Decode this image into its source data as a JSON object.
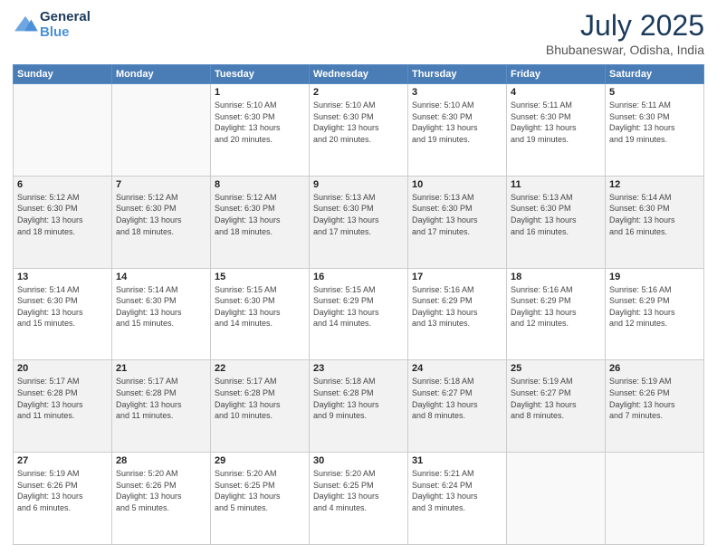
{
  "header": {
    "logo_line1": "General",
    "logo_line2": "Blue",
    "month_year": "July 2025",
    "location": "Bhubaneswar, Odisha, India"
  },
  "weekdays": [
    "Sunday",
    "Monday",
    "Tuesday",
    "Wednesday",
    "Thursday",
    "Friday",
    "Saturday"
  ],
  "weeks": [
    [
      {
        "day": "",
        "content": ""
      },
      {
        "day": "",
        "content": ""
      },
      {
        "day": "1",
        "content": "Sunrise: 5:10 AM\nSunset: 6:30 PM\nDaylight: 13 hours\nand 20 minutes."
      },
      {
        "day": "2",
        "content": "Sunrise: 5:10 AM\nSunset: 6:30 PM\nDaylight: 13 hours\nand 20 minutes."
      },
      {
        "day": "3",
        "content": "Sunrise: 5:10 AM\nSunset: 6:30 PM\nDaylight: 13 hours\nand 19 minutes."
      },
      {
        "day": "4",
        "content": "Sunrise: 5:11 AM\nSunset: 6:30 PM\nDaylight: 13 hours\nand 19 minutes."
      },
      {
        "day": "5",
        "content": "Sunrise: 5:11 AM\nSunset: 6:30 PM\nDaylight: 13 hours\nand 19 minutes."
      }
    ],
    [
      {
        "day": "6",
        "content": "Sunrise: 5:12 AM\nSunset: 6:30 PM\nDaylight: 13 hours\nand 18 minutes."
      },
      {
        "day": "7",
        "content": "Sunrise: 5:12 AM\nSunset: 6:30 PM\nDaylight: 13 hours\nand 18 minutes."
      },
      {
        "day": "8",
        "content": "Sunrise: 5:12 AM\nSunset: 6:30 PM\nDaylight: 13 hours\nand 18 minutes."
      },
      {
        "day": "9",
        "content": "Sunrise: 5:13 AM\nSunset: 6:30 PM\nDaylight: 13 hours\nand 17 minutes."
      },
      {
        "day": "10",
        "content": "Sunrise: 5:13 AM\nSunset: 6:30 PM\nDaylight: 13 hours\nand 17 minutes."
      },
      {
        "day": "11",
        "content": "Sunrise: 5:13 AM\nSunset: 6:30 PM\nDaylight: 13 hours\nand 16 minutes."
      },
      {
        "day": "12",
        "content": "Sunrise: 5:14 AM\nSunset: 6:30 PM\nDaylight: 13 hours\nand 16 minutes."
      }
    ],
    [
      {
        "day": "13",
        "content": "Sunrise: 5:14 AM\nSunset: 6:30 PM\nDaylight: 13 hours\nand 15 minutes."
      },
      {
        "day": "14",
        "content": "Sunrise: 5:14 AM\nSunset: 6:30 PM\nDaylight: 13 hours\nand 15 minutes."
      },
      {
        "day": "15",
        "content": "Sunrise: 5:15 AM\nSunset: 6:30 PM\nDaylight: 13 hours\nand 14 minutes."
      },
      {
        "day": "16",
        "content": "Sunrise: 5:15 AM\nSunset: 6:29 PM\nDaylight: 13 hours\nand 14 minutes."
      },
      {
        "day": "17",
        "content": "Sunrise: 5:16 AM\nSunset: 6:29 PM\nDaylight: 13 hours\nand 13 minutes."
      },
      {
        "day": "18",
        "content": "Sunrise: 5:16 AM\nSunset: 6:29 PM\nDaylight: 13 hours\nand 12 minutes."
      },
      {
        "day": "19",
        "content": "Sunrise: 5:16 AM\nSunset: 6:29 PM\nDaylight: 13 hours\nand 12 minutes."
      }
    ],
    [
      {
        "day": "20",
        "content": "Sunrise: 5:17 AM\nSunset: 6:28 PM\nDaylight: 13 hours\nand 11 minutes."
      },
      {
        "day": "21",
        "content": "Sunrise: 5:17 AM\nSunset: 6:28 PM\nDaylight: 13 hours\nand 11 minutes."
      },
      {
        "day": "22",
        "content": "Sunrise: 5:17 AM\nSunset: 6:28 PM\nDaylight: 13 hours\nand 10 minutes."
      },
      {
        "day": "23",
        "content": "Sunrise: 5:18 AM\nSunset: 6:28 PM\nDaylight: 13 hours\nand 9 minutes."
      },
      {
        "day": "24",
        "content": "Sunrise: 5:18 AM\nSunset: 6:27 PM\nDaylight: 13 hours\nand 8 minutes."
      },
      {
        "day": "25",
        "content": "Sunrise: 5:19 AM\nSunset: 6:27 PM\nDaylight: 13 hours\nand 8 minutes."
      },
      {
        "day": "26",
        "content": "Sunrise: 5:19 AM\nSunset: 6:26 PM\nDaylight: 13 hours\nand 7 minutes."
      }
    ],
    [
      {
        "day": "27",
        "content": "Sunrise: 5:19 AM\nSunset: 6:26 PM\nDaylight: 13 hours\nand 6 minutes."
      },
      {
        "day": "28",
        "content": "Sunrise: 5:20 AM\nSunset: 6:26 PM\nDaylight: 13 hours\nand 5 minutes."
      },
      {
        "day": "29",
        "content": "Sunrise: 5:20 AM\nSunset: 6:25 PM\nDaylight: 13 hours\nand 5 minutes."
      },
      {
        "day": "30",
        "content": "Sunrise: 5:20 AM\nSunset: 6:25 PM\nDaylight: 13 hours\nand 4 minutes."
      },
      {
        "day": "31",
        "content": "Sunrise: 5:21 AM\nSunset: 6:24 PM\nDaylight: 13 hours\nand 3 minutes."
      },
      {
        "day": "",
        "content": ""
      },
      {
        "day": "",
        "content": ""
      }
    ]
  ]
}
